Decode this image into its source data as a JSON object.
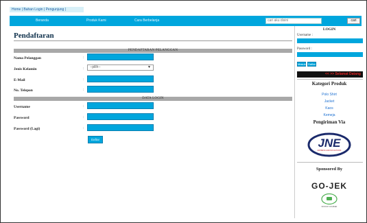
{
  "status_bar": "Home | Bahan Login | Pengunjung |",
  "nav": {
    "items": [
      "Beranda",
      "Produk Kami",
      "Cara Berbelanja"
    ],
    "search_placeholder": "cari aku disini",
    "search_button": "cari"
  },
  "page": {
    "title": "Pendaftaran",
    "section_customer": "PENDAFTARAN PELANGGAN",
    "section_login": "DATA LOGIN",
    "fields": {
      "nama": "Nama Pelanggan",
      "jk": "Jenis Kelamin",
      "email": "E-Mail",
      "telp": "No. Telepon",
      "username": "Username",
      "password": "Password",
      "password2": "Password (Lagi)"
    },
    "colon": ":",
    "gender_select": "--pilih--",
    "submit": "Daftar"
  },
  "sidebar": {
    "login_title": "LOGIN",
    "username_label": "Username :",
    "password_label": "Password :",
    "login_button": "Masuk",
    "register_button": "Daftar",
    "marquee": "<< >> Selamat Datang",
    "category_title": "Kategori Produk",
    "categories": [
      "Polo Shirt",
      "Jacket",
      "Kaos",
      "Kemeja"
    ],
    "shipping_title": "Pengiriman Via",
    "jne_logo": "JNE",
    "jne_tagline": "EXPRESS ACROSS NATIONS",
    "sponsor_title": "Sponsored By",
    "gojek_logo": "GO-JEK",
    "gojek_sub": "INSTANT COURIER"
  },
  "colors": {
    "accent": "#00a6dd",
    "marquee_text": "#e02222"
  }
}
